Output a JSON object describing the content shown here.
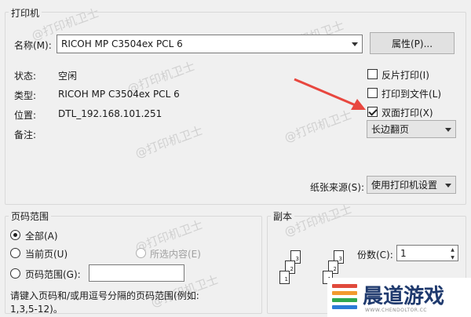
{
  "printer_group": {
    "title": "打印机",
    "name_label": "名称(M):",
    "printer_name": "RICOH MP C3504ex PCL 6",
    "properties_button": "属性(P)...",
    "status_label": "状态:",
    "status_value": "空闲",
    "type_label": "类型:",
    "type_value": "RICOH MP C3504ex PCL 6",
    "location_label": "位置:",
    "location_value": "DTL_192.168.101.251",
    "comment_label": "备注:",
    "reverse_print": {
      "label": "反片打印(I)",
      "checked": false
    },
    "print_to_file": {
      "label": "打印到文件(L)",
      "checked": false
    },
    "duplex": {
      "label": "双面打印(X)",
      "checked": true
    },
    "flip_select": "长边翻页",
    "paper_source_label": "纸张来源(S):",
    "paper_source_value": "使用打印机设置"
  },
  "page_range_group": {
    "title": "页码范围",
    "all_label": "全部(A)",
    "current_label": "当前页(U)",
    "selection_label": "所选内容(E)",
    "pages_label": "页码范围(G):",
    "pages_value": "",
    "hint": "请键入页码和/或用逗号分隔的页码范围(例如:",
    "hint_example": "1,3,5-12)。"
  },
  "copies_group": {
    "title": "副本",
    "copies_label": "份数(C):",
    "copies_value": "1",
    "collate_pages": [
      "1",
      "2",
      "3"
    ]
  },
  "watermark": "@打印机卫士",
  "brand": {
    "name": "晨道游戏",
    "domain": "WWW.CHENDOLTOR.CC"
  },
  "colors": {
    "arrow": "#e8473f",
    "window_bg": "#f0f0f0",
    "brand_text": "#1f3a6e"
  }
}
